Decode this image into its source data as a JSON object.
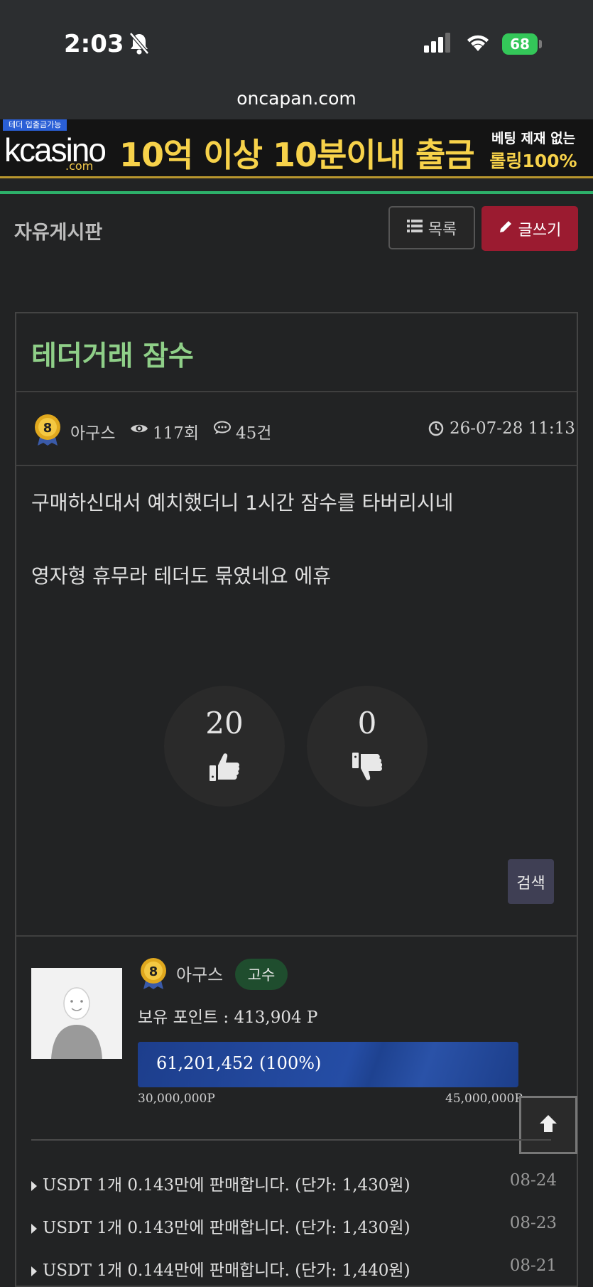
{
  "status_bar": {
    "time": "2:03",
    "battery": "68"
  },
  "browser": {
    "url": "oncapan.com"
  },
  "banner": {
    "tag": "테더 입출금가능",
    "logo": "kcasino",
    "logo_sub": ".com",
    "headline": "10억 이상 10분이내 출금",
    "side_line1": "베팅 제재 없는",
    "side_line2": "롤링100%"
  },
  "board": {
    "title": "자유게시판",
    "list_button": "목록",
    "write_button": "글쓰기"
  },
  "post": {
    "title": "테더거래 잠수",
    "level": "8",
    "author": "아구스",
    "views": "117회",
    "comments": "45건",
    "datetime": "26-07-28 11:13",
    "content": [
      "구매하신대서 예치했더니 1시간 잠수를 타버리시네",
      "영자형 휴무라 테더도 묶였네요 에휴"
    ],
    "likes": "20",
    "dislikes": "0",
    "search_button": "검색"
  },
  "profile": {
    "level": "8",
    "nickname": "아구스",
    "rank": "고수",
    "points": "보유 포인트 : 413,904 P",
    "progress_text": "61,201,452 (100%)",
    "progress_percent": 100,
    "scale_min": "30,000,000P",
    "scale_max": "45,000,000P"
  },
  "related_posts": [
    {
      "title": "USDT 1개 0.143만에 판매합니다. (단가: 1,430원)",
      "date": "08-24"
    },
    {
      "title": "USDT 1개 0.143만에 판매합니다. (단가: 1,430원)",
      "date": "08-23"
    },
    {
      "title": "USDT 1개 0.144만에 판매합니다. (단가: 1,440원)",
      "date": "08-21"
    }
  ],
  "colors": {
    "title_green": "#8fcf88",
    "write_button": "#9b1b30",
    "rank_badge": "#1f4d2e",
    "progress": "#1f3f8f",
    "accent_line": "#2db06a"
  }
}
